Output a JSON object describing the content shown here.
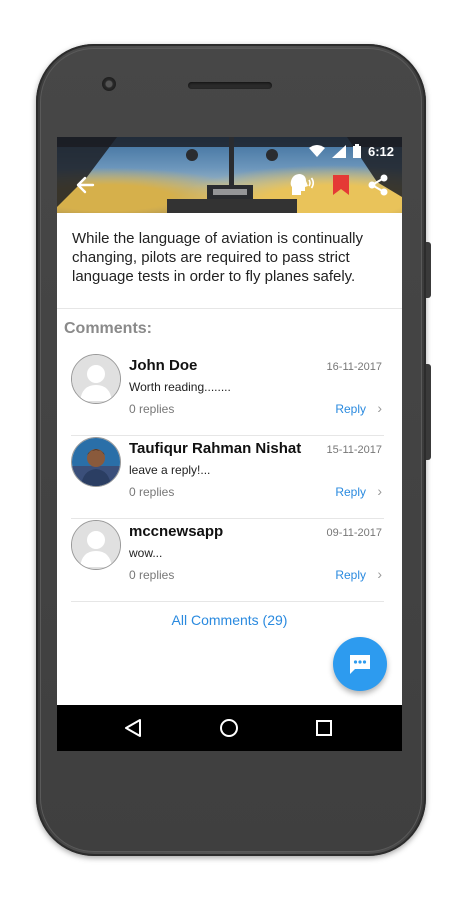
{
  "status_bar": {
    "time": "6:12"
  },
  "toolbar": {
    "back_icon": "arrow-back-icon",
    "speak_icon": "text-to-speech-icon",
    "bookmark_icon": "bookmark-icon",
    "share_icon": "share-icon",
    "bookmark_color": "#e53935"
  },
  "article": {
    "text": "While the language of aviation is continually changing, pilots are required to pass strict language tests in order to fly planes safely."
  },
  "comments": {
    "title": "Comments:",
    "items": [
      {
        "name": "John Doe",
        "date": "16-11-2017",
        "text": "Worth reading........",
        "replies": "0 replies",
        "reply_label": "Reply"
      },
      {
        "name": "Taufiqur Rahman Nishat",
        "date": "15-11-2017",
        "text": "leave a reply!...",
        "replies": "0 replies",
        "reply_label": "Reply"
      },
      {
        "name": "mccnewsapp",
        "date": "09-11-2017",
        "text": "wow...",
        "replies": "0 replies",
        "reply_label": "Reply"
      }
    ],
    "all_comments_label": "All Comments (29)"
  },
  "fab": {
    "icon": "chat-bubble-icon",
    "color": "#2d9bef"
  },
  "nav": {
    "back": "nav-back-icon",
    "home": "nav-home-icon",
    "recents": "nav-recents-icon"
  },
  "colors": {
    "link": "#2a8adf",
    "muted": "#8a8a8a"
  }
}
